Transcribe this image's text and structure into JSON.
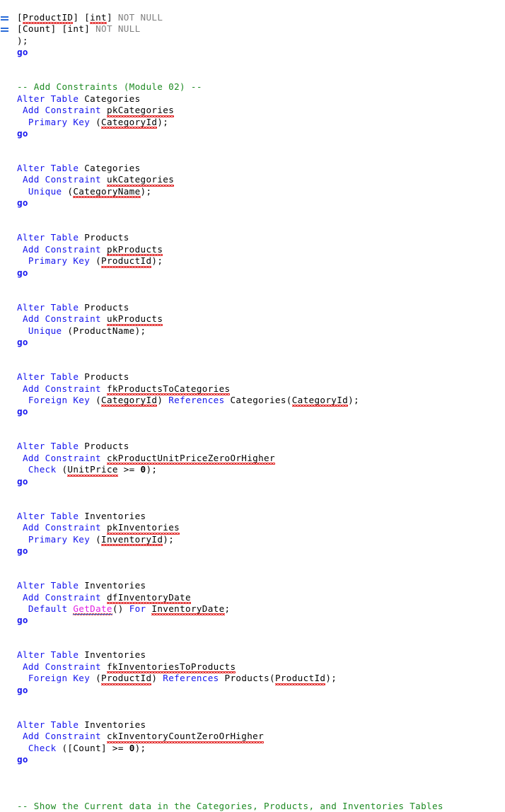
{
  "editor": {
    "language": "sql",
    "colors": {
      "keyword": "#1515ee",
      "comment": "#1d8a22",
      "identifier": "#000000",
      "datatype_gray": "#808080",
      "function": "#e21fe2",
      "spellcheck_squiggle": "#e01b1b",
      "link_underline": "#2a6cd8",
      "background": "#ffffff"
    }
  },
  "code": {
    "l1": {
      "marker": true,
      "bracket_open": "[",
      "col": "ProductID",
      "bracket_close": "] ",
      "type_open": "[",
      "type": "int",
      "type_close": "] ",
      "nullability": "NOT NULL"
    },
    "l2": {
      "marker": true,
      "bracket_open": "[",
      "col": "Count",
      "bracket_close": "] ",
      "type_open": "[",
      "type": "int",
      "type_close": "] ",
      "nullability": "NOT NULL"
    },
    "l3": ");",
    "l4": "go",
    "comment_add_constraints": "-- Add Constraints (Module 02) --",
    "b1": {
      "alter": "Alter",
      "table": "Table",
      "name": "Categories",
      "add": "Add",
      "constraint": "Constraint",
      "cname": "pkCategories",
      "type1": "Primary",
      "type2": "Key",
      "open": " (",
      "col": "CategoryId",
      "close": ");",
      "go": "go"
    },
    "b2": {
      "alter": "Alter",
      "table": "Table",
      "name": "Categories",
      "add": "Add",
      "constraint": "Constraint",
      "cname": "ukCategories",
      "type1": "Unique",
      "open": " (",
      "col": "CategoryName",
      "close": ");",
      "go": "go"
    },
    "b3": {
      "alter": "Alter",
      "table": "Table",
      "name": "Products",
      "add": "Add",
      "constraint": "Constraint",
      "cname": "pkProducts",
      "type1": "Primary",
      "type2": "Key",
      "open": " (",
      "col": "ProductId",
      "close": ");",
      "go": "go"
    },
    "b4": {
      "alter": "Alter",
      "table": "Table",
      "name": "Products",
      "add": "Add",
      "constraint": "Constraint",
      "cname": "ukProducts",
      "type1": "Unique",
      "open": " (",
      "col": "ProductName",
      "close": ");",
      "go": "go"
    },
    "b5": {
      "alter": "Alter",
      "table": "Table",
      "name": "Products",
      "add": "Add",
      "constraint": "Constraint",
      "cname": "fkProductsToCategories",
      "type1": "Foreign",
      "type2": "Key",
      "open": " (",
      "col": "CategoryId",
      "mid": ") ",
      "references": "References",
      "reftable": " Categories(",
      "refcol": "CategoryId",
      "close": ");",
      "go": "go"
    },
    "b6": {
      "alter": "Alter",
      "table": "Table",
      "name": "Products",
      "add": "Add",
      "constraint": "Constraint",
      "cname": "ckProductUnitPriceZeroOrHigher",
      "type1": "Check",
      "open": " (",
      "col": "UnitPrice",
      "op": " >= ",
      "value": "0",
      "close": ");",
      "go": "go"
    },
    "b7": {
      "alter": "Alter",
      "table": "Table",
      "name": "Inventories",
      "add": "Add",
      "constraint": "Constraint",
      "cname": "pkInventories",
      "type1": "Primary",
      "type2": "Key",
      "open": " (",
      "col": "InventoryId",
      "close": ");",
      "go": "go"
    },
    "b8": {
      "alter": "Alter",
      "table": "Table",
      "name": "Inventories",
      "add": "Add",
      "constraint": "Constraint",
      "cname": "dfInventoryDate",
      "type1": "Default",
      "fn": "GetDate",
      "fnargs": "()",
      "for": "For",
      "col": "InventoryDate",
      "close": ";",
      "go": "go"
    },
    "b9": {
      "alter": "Alter",
      "table": "Table",
      "name": "Inventories",
      "add": "Add",
      "constraint": "Constraint",
      "cname": "fkInventoriesToProducts",
      "type1": "Foreign",
      "type2": "Key",
      "open": " (",
      "col": "ProductId",
      "mid": ") ",
      "references": "References",
      "reftable": " Products(",
      "refcol": "ProductId",
      "close": ");",
      "go": "go"
    },
    "b10": {
      "alter": "Alter",
      "table": "Table",
      "name": "Inventories",
      "add": "Add",
      "constraint": "Constraint",
      "cname": "ckInventoryCountZeroOrHigher",
      "type1": "Check",
      "open": " ([",
      "col": "Count",
      "colclose": "] ",
      "op": ">= ",
      "value": "0",
      "close": ");",
      "go": "go"
    },
    "comment_show_current": "-- Show the Current data in the Categories, Products, and Inventories Tables"
  }
}
